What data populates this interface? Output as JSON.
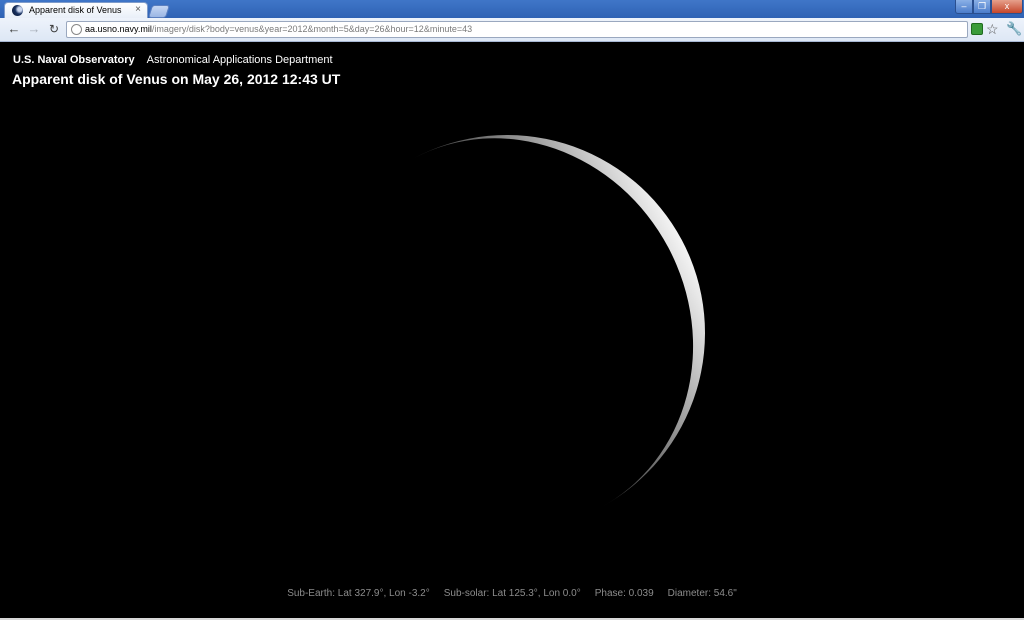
{
  "browser": {
    "tab_title": "Apparent disk of Venus",
    "tab_close": "×",
    "url_host": "aa.usno.navy.mil",
    "url_path": "/imagery/disk?body=venus&year=2012&month=5&day=26&hour=12&minute=43",
    "icons": {
      "back": "arrow-left",
      "forward": "arrow-right",
      "reload": "reload",
      "bookmark": "star",
      "menu": "wrench"
    }
  },
  "header": {
    "org_name": "U.S. Naval Observatory",
    "dept_name": "Astronomical Applications Department",
    "title": "Apparent disk of Venus on May 26, 2012 12:43 UT"
  },
  "footer": {
    "sub_earth": "Sub-Earth: Lat 327.9°, Lon -3.2°",
    "sub_solar": "Sub-solar: Lat 125.3°, Lon 0.0°",
    "phase": "Phase: 0.039",
    "diameter": "Diameter: 54.6\""
  },
  "image": {
    "phase": 0.039,
    "lit_color": "#f2f2f2",
    "background": "#000000"
  }
}
